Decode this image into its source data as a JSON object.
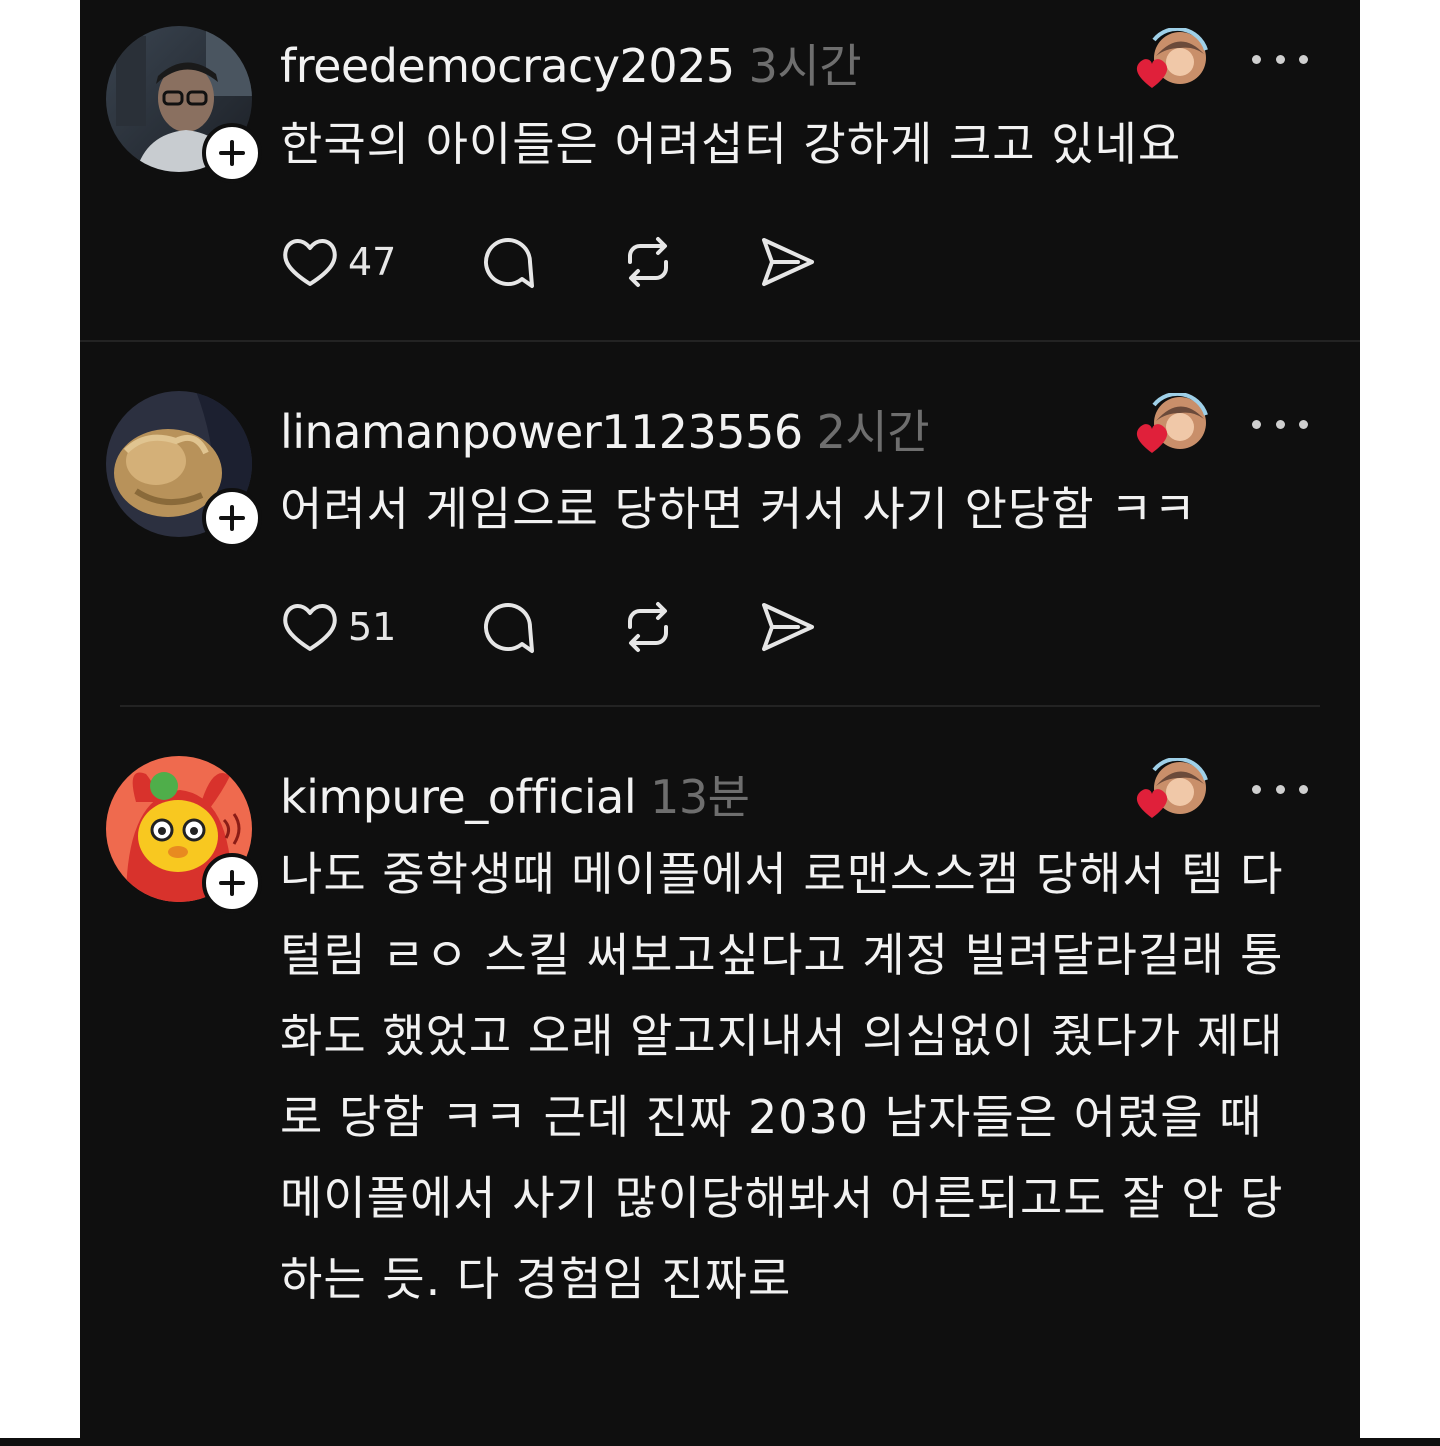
{
  "posts": [
    {
      "username": "freedemocracy2025",
      "time": "3시간",
      "text": "한국의 아이들은 어려섭터  강하게 크고 있네요",
      "likes": "47",
      "avatar": "man-with-glasses-photo"
    },
    {
      "username": "linamanpower1123556",
      "time": "2시간",
      "text": "어려서 게임으로 당하면 커서 사기 안당함 ㅋㅋ",
      "likes": "51",
      "avatar": "fluffy-dog-photo"
    },
    {
      "username": "kimpure_official",
      "time": "13분",
      "text": "나도 중학생때 메이플에서 로맨스스캠 당해서 템 다 털림 ㄹㅇ 스킬 써보고싶다고 계정 빌려달라길래 통화도 했었고 오래 알고지내서 의심없이 줬다가 제대로 당함 ㅋㅋ 근데 진짜 2030 남자들은 어렸을 때 메이플에서 사기 많이당해봐서 어른되고도 잘 안 당하는 듯. 다 경험임 진짜로",
      "avatar": "cartoon-mascot-avatar"
    }
  ],
  "icons": {
    "like": "heart-icon",
    "reply": "comment-icon",
    "repost": "repost-icon",
    "share": "send-icon",
    "more": "more-dots-icon",
    "follow": "plus-icon"
  },
  "colors": {
    "background": "#0f0f0f",
    "text": "#f2f2f2",
    "muted": "#6e6e6e",
    "heart": "#e0203a"
  }
}
